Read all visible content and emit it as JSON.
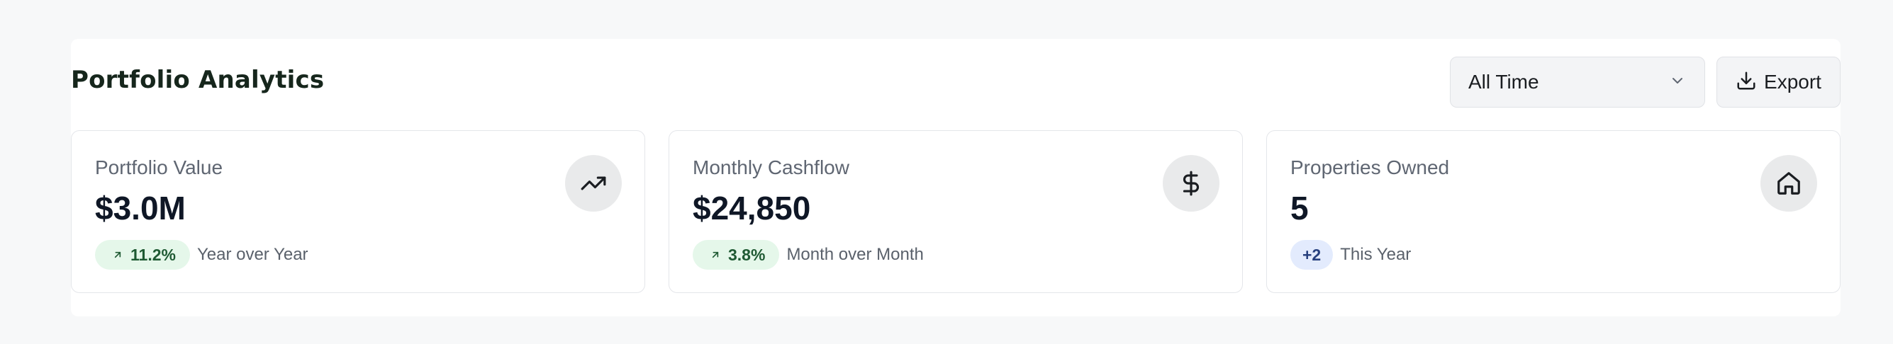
{
  "header": {
    "title": "Portfolio Analytics",
    "range_select": {
      "value": "All Time"
    },
    "export_label": "Export"
  },
  "cards": [
    {
      "title": "Portfolio Value",
      "value": "$3.0M",
      "icon": "trending-up-icon",
      "badge": "11.2%",
      "badge_icon": "arrow-up-right-icon",
      "badge_tone": "green",
      "caption": "Year over Year"
    },
    {
      "title": "Monthly Cashflow",
      "value": "$24,850",
      "icon": "dollar-icon",
      "badge": "3.8%",
      "badge_icon": "arrow-up-right-icon",
      "badge_tone": "green",
      "caption": "Month over Month"
    },
    {
      "title": "Properties Owned",
      "value": "5",
      "icon": "home-icon",
      "badge": "+2",
      "badge_tone": "blue",
      "caption": "This Year"
    }
  ],
  "colors": {
    "page_bg": "#f7f8f9",
    "title": "#16261c",
    "positive_badge_bg": "#e5f7ea",
    "positive_badge_text": "#1f5a33",
    "info_badge_bg": "#e3ebfd",
    "info_badge_text": "#27407e"
  }
}
